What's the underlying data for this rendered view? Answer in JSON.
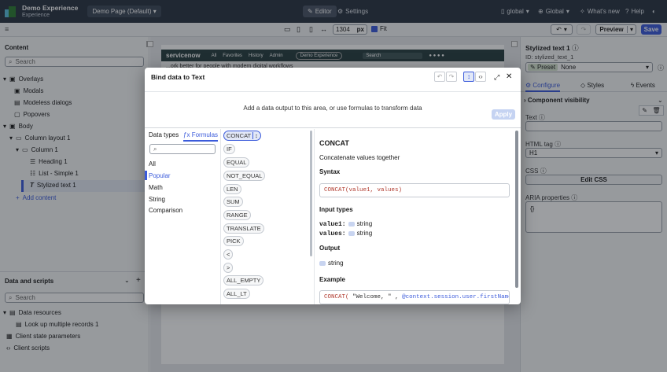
{
  "topbar": {
    "app_title": "Demo Experience",
    "app_subtitle": "Experience",
    "page_selector": "Demo Page (Default)",
    "editor": "Editor",
    "settings": "Settings",
    "scope_global1": "global",
    "scope_global2": "Global",
    "whats_new": "What's new",
    "help": "Help"
  },
  "toolbar": {
    "width_value": "1304",
    "width_unit": "px",
    "fit_label": "Fit",
    "preview": "Preview",
    "save": "Save"
  },
  "left_panel": {
    "content_title": "Content",
    "search_placeholder": "Search",
    "tree": [
      {
        "label": "Overlays"
      },
      {
        "label": "Modals"
      },
      {
        "label": "Modeless dialogs"
      },
      {
        "label": "Popovers"
      },
      {
        "label": "Body"
      },
      {
        "label": "Column layout 1"
      },
      {
        "label": "Column 1"
      },
      {
        "label": "Heading 1"
      },
      {
        "label": "List - Simple 1"
      },
      {
        "label": "Stylized text 1"
      }
    ],
    "add_content": "Add content",
    "data_title": "Data and scripts",
    "data_search_placeholder": "Search",
    "data_tree": [
      {
        "label": "Data resources"
      },
      {
        "label": "Look up multiple records 1"
      },
      {
        "label": "Client state parameters"
      },
      {
        "label": "Client scripts"
      }
    ]
  },
  "canvas": {
    "brand": "servicenow",
    "nav": [
      "All",
      "Favorites",
      "History",
      "Admin"
    ],
    "pill": "Demo Experience",
    "search": "Search",
    "snippet": "...ork better for people with modern digital workflows"
  },
  "right_panel": {
    "title": "Stylized text 1",
    "id_label": "ID: stylized_text_1",
    "preset_label": "Preset",
    "preset_value": "None",
    "tabs": [
      "Configure",
      "Styles",
      "Events"
    ],
    "visibility": "Component visibility",
    "text_label": "Text",
    "html_tag_label": "HTML tag",
    "html_tag_value": "H1",
    "css_label": "CSS",
    "edit_css": "Edit CSS",
    "aria_label": "ARIA properties",
    "aria_value": "{}"
  },
  "modal": {
    "title": "Bind data to Text",
    "hint": "Add a data output to this area, or use formulas to transform data",
    "apply": "Apply",
    "tab_data_types": "Data types",
    "tab_formulas": "Formulas",
    "categories": [
      "All",
      "Popular",
      "Math",
      "String",
      "Comparison"
    ],
    "functions": [
      "CONCAT",
      "IF",
      "EQUAL",
      "NOT_EQUAL",
      "LEN",
      "SUM",
      "RANGE",
      "TRANSLATE",
      "PICK",
      "<",
      ">",
      "ALL_EMPTY",
      "ALL_LT"
    ],
    "detail": {
      "name": "CONCAT",
      "description": "Concatenate values together",
      "syntax_label": "Syntax",
      "syntax": "CONCAT(value1, values)",
      "input_types_label": "Input types",
      "inputs": [
        {
          "name": "value1:",
          "type": "string"
        },
        {
          "name": "values:",
          "type": "string"
        }
      ],
      "output_label": "Output",
      "output_type": "string",
      "example_label": "Example",
      "example_fn": "CONCAT(",
      "example_str": "\"Welcome, \"",
      "example_sep": ",",
      "example_ref": "@context.session.user.firstName",
      "example_end": ")"
    }
  },
  "colors": {
    "topbar": "#2a3443",
    "accent": "#3b5bdb",
    "save": "#3b5bdb"
  }
}
